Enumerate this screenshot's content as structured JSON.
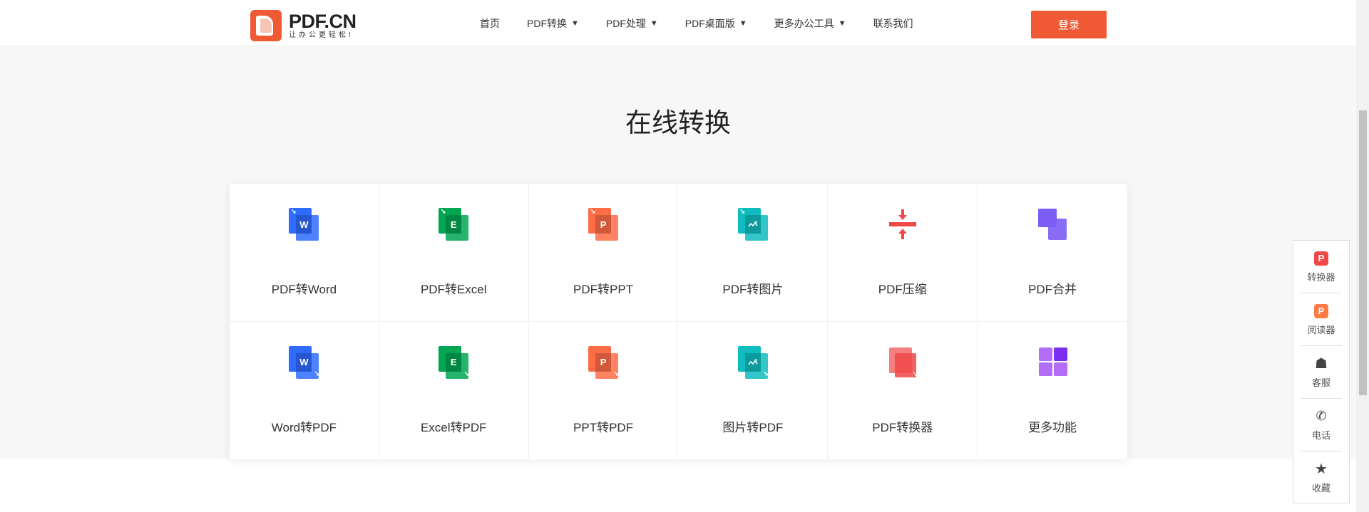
{
  "header": {
    "logo_title": "PDF.CN",
    "logo_slogan": "让办公更轻松!",
    "nav": [
      {
        "label": "首页",
        "dropdown": false
      },
      {
        "label": "PDF转换",
        "dropdown": true
      },
      {
        "label": "PDF处理",
        "dropdown": true
      },
      {
        "label": "PDF桌面版",
        "dropdown": true
      },
      {
        "label": "更多办公工具",
        "dropdown": true
      },
      {
        "label": "联系我们",
        "dropdown": false
      }
    ],
    "caret": "▼",
    "login": "登录"
  },
  "main": {
    "title": "在线转换",
    "tools": [
      {
        "label": "PDF转Word",
        "icon": "word-icon",
        "letter": "W",
        "color": "#2f6bff"
      },
      {
        "label": "PDF转Excel",
        "icon": "excel-icon",
        "letter": "E",
        "color": "#00a651"
      },
      {
        "label": "PDF转PPT",
        "icon": "ppt-icon",
        "letter": "P",
        "color": "#ff6d47"
      },
      {
        "label": "PDF转图片",
        "icon": "image-icon",
        "letter": "",
        "color": "#0fbcbf"
      },
      {
        "label": "PDF压缩",
        "icon": "compress-icon",
        "letter": "",
        "color": "#f04848"
      },
      {
        "label": "PDF合并",
        "icon": "merge-icon",
        "letter": "",
        "color": "#7b5cf5"
      },
      {
        "label": "Word转PDF",
        "icon": "word-icon",
        "letter": "W",
        "color": "#2f6bff"
      },
      {
        "label": "Excel转PDF",
        "icon": "excel-icon",
        "letter": "E",
        "color": "#00a651"
      },
      {
        "label": "PPT转PDF",
        "icon": "ppt-icon",
        "letter": "P",
        "color": "#ff6d47"
      },
      {
        "label": "图片转PDF",
        "icon": "image-icon",
        "letter": "",
        "color": "#0fbcbf"
      },
      {
        "label": "PDF转换器",
        "icon": "converter-icon",
        "letter": "",
        "color": "#f04848"
      },
      {
        "label": "更多功能",
        "icon": "grid-icon",
        "letter": "",
        "color": "#a45cf5"
      }
    ]
  },
  "sidebar": [
    {
      "label": "转换器",
      "icon": "converter-app-icon"
    },
    {
      "label": "阅读器",
      "icon": "reader-app-icon"
    },
    {
      "label": "客服",
      "icon": "qq-icon"
    },
    {
      "label": "电话",
      "icon": "phone-icon"
    },
    {
      "label": "收藏",
      "icon": "star-icon"
    }
  ],
  "colors": {
    "brand": "#ef5a35"
  }
}
